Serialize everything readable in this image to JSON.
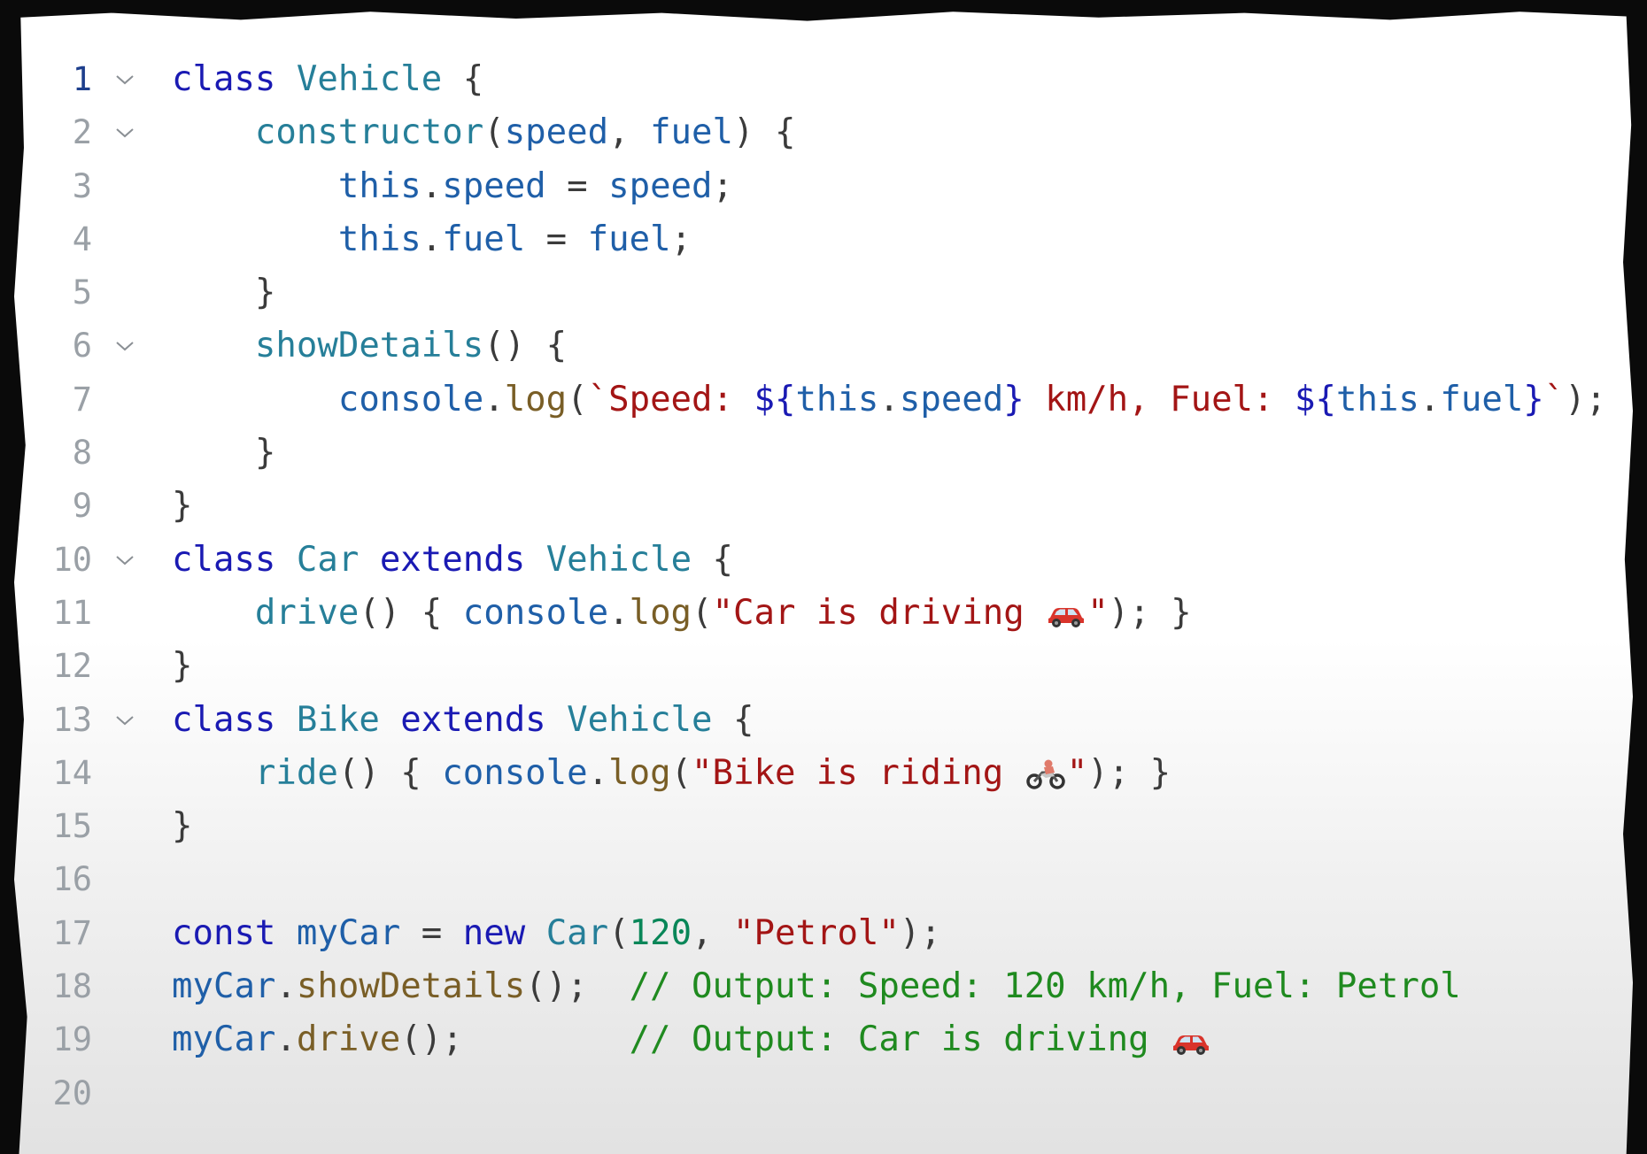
{
  "editor": {
    "active_line": 1,
    "foldable_lines": [
      1,
      2,
      6,
      10,
      13
    ],
    "lines": [
      {
        "n": "1",
        "indent": 0,
        "tokens": [
          [
            "kw",
            "class"
          ],
          [
            "pu",
            " "
          ],
          [
            "ty",
            "Vehicle"
          ],
          [
            "pu",
            " {"
          ]
        ]
      },
      {
        "n": "2",
        "indent": 1,
        "tokens": [
          [
            "ty",
            "constructor"
          ],
          [
            "pu",
            "("
          ],
          [
            "vr",
            "speed"
          ],
          [
            "pu",
            ", "
          ],
          [
            "vr",
            "fuel"
          ],
          [
            "pu",
            ") {"
          ]
        ]
      },
      {
        "n": "3",
        "indent": 2,
        "tokens": [
          [
            "vr",
            "this"
          ],
          [
            "pu",
            "."
          ],
          [
            "vr",
            "speed"
          ],
          [
            "pu",
            " = "
          ],
          [
            "vr",
            "speed"
          ],
          [
            "pu",
            ";"
          ]
        ]
      },
      {
        "n": "4",
        "indent": 2,
        "tokens": [
          [
            "vr",
            "this"
          ],
          [
            "pu",
            "."
          ],
          [
            "vr",
            "fuel"
          ],
          [
            "pu",
            " = "
          ],
          [
            "vr",
            "fuel"
          ],
          [
            "pu",
            ";"
          ]
        ]
      },
      {
        "n": "5",
        "indent": 1,
        "tokens": [
          [
            "pu",
            "}"
          ]
        ]
      },
      {
        "n": "6",
        "indent": 1,
        "tokens": [
          [
            "ty",
            "showDetails"
          ],
          [
            "pu",
            "() {"
          ]
        ]
      },
      {
        "n": "7",
        "indent": 2,
        "tokens": [
          [
            "vr",
            "console"
          ],
          [
            "pu",
            "."
          ],
          [
            "fn",
            "log"
          ],
          [
            "pu",
            "("
          ],
          [
            "st",
            "`Speed: "
          ],
          [
            "tb",
            "${"
          ],
          [
            "vr",
            "this"
          ],
          [
            "pu",
            "."
          ],
          [
            "vr",
            "speed"
          ],
          [
            "tb",
            "}"
          ],
          [
            "st",
            " km/h, Fuel: "
          ],
          [
            "tb",
            "${"
          ],
          [
            "vr",
            "this"
          ],
          [
            "pu",
            "."
          ],
          [
            "vr",
            "fuel"
          ],
          [
            "tb",
            "}"
          ],
          [
            "st",
            "`"
          ],
          [
            "pu",
            ");"
          ]
        ]
      },
      {
        "n": "8",
        "indent": 1,
        "tokens": [
          [
            "pu",
            "}"
          ]
        ]
      },
      {
        "n": "9",
        "indent": 0,
        "tokens": [
          [
            "pu",
            "}"
          ]
        ]
      },
      {
        "n": "10",
        "indent": 0,
        "tokens": [
          [
            "kw",
            "class"
          ],
          [
            "pu",
            " "
          ],
          [
            "ty",
            "Car"
          ],
          [
            "pu",
            " "
          ],
          [
            "kw",
            "extends"
          ],
          [
            "pu",
            " "
          ],
          [
            "ty",
            "Vehicle"
          ],
          [
            "pu",
            " {"
          ]
        ]
      },
      {
        "n": "11",
        "indent": 1,
        "tokens": [
          [
            "ty",
            "drive"
          ],
          [
            "pu",
            "() { "
          ],
          [
            "vr",
            "console"
          ],
          [
            "pu",
            "."
          ],
          [
            "fn",
            "log"
          ],
          [
            "pu",
            "("
          ],
          [
            "st",
            "\"Car is driving "
          ],
          [
            "emoji",
            "car"
          ],
          [
            "st",
            "\""
          ],
          [
            "pu",
            "); }"
          ]
        ]
      },
      {
        "n": "12",
        "indent": 0,
        "tokens": [
          [
            "pu",
            "}"
          ]
        ]
      },
      {
        "n": "13",
        "indent": 0,
        "tokens": [
          [
            "kw",
            "class"
          ],
          [
            "pu",
            " "
          ],
          [
            "ty",
            "Bike"
          ],
          [
            "pu",
            " "
          ],
          [
            "kw",
            "extends"
          ],
          [
            "pu",
            " "
          ],
          [
            "ty",
            "Vehicle"
          ],
          [
            "pu",
            " {"
          ]
        ]
      },
      {
        "n": "14",
        "indent": 1,
        "tokens": [
          [
            "ty",
            "ride"
          ],
          [
            "pu",
            "() { "
          ],
          [
            "vr",
            "console"
          ],
          [
            "pu",
            "."
          ],
          [
            "fn",
            "log"
          ],
          [
            "pu",
            "("
          ],
          [
            "st",
            "\"Bike is riding "
          ],
          [
            "emoji",
            "motorbike"
          ],
          [
            "st",
            "\""
          ],
          [
            "pu",
            "); }"
          ]
        ]
      },
      {
        "n": "15",
        "indent": 0,
        "tokens": [
          [
            "pu",
            "}"
          ]
        ]
      },
      {
        "n": "16",
        "indent": 0,
        "tokens": []
      },
      {
        "n": "17",
        "indent": 0,
        "tokens": [
          [
            "kw",
            "const"
          ],
          [
            "pu",
            " "
          ],
          [
            "vr",
            "myCar"
          ],
          [
            "pu",
            " = "
          ],
          [
            "kw",
            "new"
          ],
          [
            "pu",
            " "
          ],
          [
            "ty",
            "Car"
          ],
          [
            "pu",
            "("
          ],
          [
            "nm",
            "120"
          ],
          [
            "pu",
            ", "
          ],
          [
            "st",
            "\"Petrol\""
          ],
          [
            "pu",
            ");"
          ]
        ]
      },
      {
        "n": "18",
        "indent": 0,
        "tokens": [
          [
            "vr",
            "myCar"
          ],
          [
            "pu",
            "."
          ],
          [
            "fn",
            "showDetails"
          ],
          [
            "pu",
            "();  "
          ],
          [
            "cm",
            "// Output: Speed: 120 km/h, Fuel: Petrol"
          ]
        ]
      },
      {
        "n": "19",
        "indent": 0,
        "tokens": [
          [
            "vr",
            "myCar"
          ],
          [
            "pu",
            "."
          ],
          [
            "fn",
            "drive"
          ],
          [
            "pu",
            "();        "
          ],
          [
            "cm",
            "// Output: Car is driving "
          ],
          [
            "emoji",
            "car"
          ]
        ]
      },
      {
        "n": "20",
        "indent": 0,
        "tokens": []
      }
    ]
  }
}
